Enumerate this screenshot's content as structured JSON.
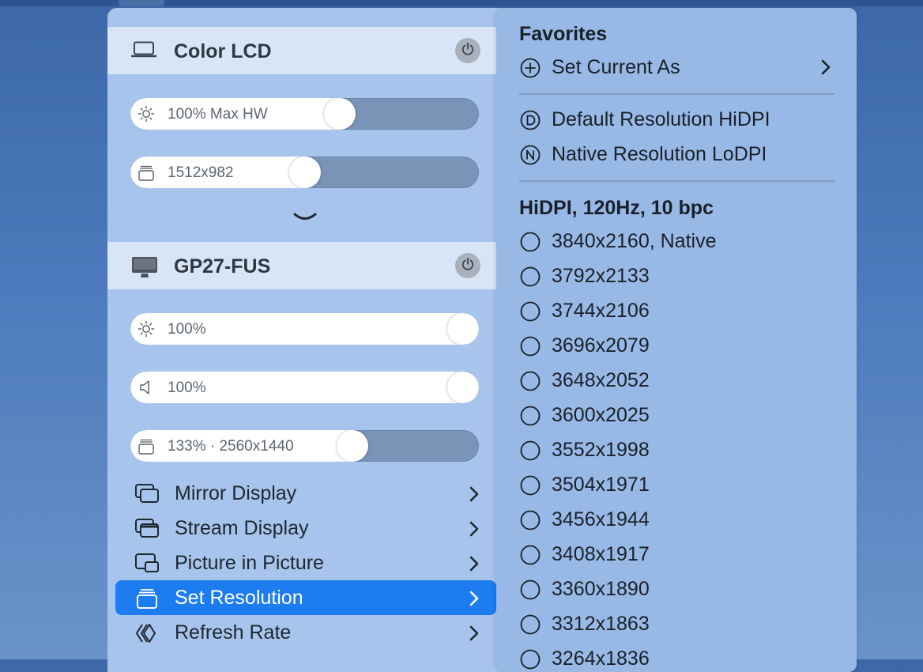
{
  "displays": [
    {
      "name": "Color LCD",
      "icon": "laptop-icon",
      "sliders": [
        {
          "icon": "brightness-icon",
          "label": "100% Max HW",
          "level": 0.61
        },
        {
          "icon": "resolution-icon",
          "label": "1512x982",
          "level": 0.5
        }
      ]
    },
    {
      "name": "GP27-FUS",
      "icon": "monitor-icon",
      "sliders": [
        {
          "icon": "brightness-icon",
          "label": "100%",
          "level": 1.0
        },
        {
          "icon": "volume-icon",
          "label": "100%",
          "level": 1.0
        },
        {
          "icon": "resolution-icon",
          "label": "133% · 2560x1440",
          "level": 0.65
        }
      ]
    }
  ],
  "menu": [
    {
      "label": "Mirror Display",
      "icon": "mirror-icon"
    },
    {
      "label": "Stream Display",
      "icon": "stream-icon"
    },
    {
      "label": "Picture in Picture",
      "icon": "pip-icon"
    },
    {
      "label": "Set Resolution",
      "icon": "resolution-icon",
      "selected": true
    },
    {
      "label": "Refresh Rate",
      "icon": "refresh-icon"
    }
  ],
  "submenu": {
    "favorites_title": "Favorites",
    "set_current_as": "Set Current As",
    "default_resolution": "Default Resolution HiDPI",
    "native_resolution": "Native Resolution LoDPI",
    "hidpi_title": "HiDPI, 120Hz, 10 bpc",
    "resolutions": [
      "3840x2160, Native",
      "3792x2133",
      "3744x2106",
      "3696x2079",
      "3648x2052",
      "3600x2025",
      "3552x1998",
      "3504x1971",
      "3456x1944",
      "3408x1917",
      "3360x1890",
      "3312x1863",
      "3264x1836"
    ]
  },
  "colors": {
    "selected": "#1c7cf0",
    "panel_bg": "#a6c4ec",
    "submenu_bg": "#98b9e6"
  }
}
